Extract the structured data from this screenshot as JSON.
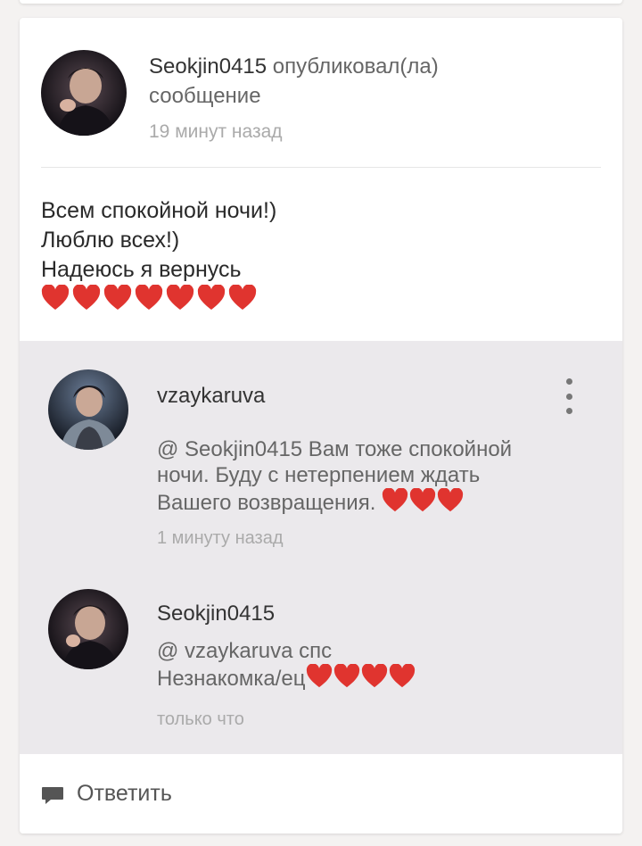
{
  "post": {
    "author": "Seokjin0415",
    "action": "опубликовал(ла)",
    "action_line2": "сообщение",
    "time": "19 минут назад",
    "body": [
      "Всем спокойной ночи!)",
      "Люблю всех!)",
      "Надеюсь я вернусь"
    ],
    "hearts": "❤️❤️❤️❤️❤️❤️❤️"
  },
  "comments": [
    {
      "author": "vzaykaruva",
      "text_line1": "@ Seokjin0415   Вам тоже спокойной",
      "text_line2": "ночи. Буду с нетерпением ждать",
      "text_line3": "Вашего возвращения.",
      "hearts": "❤️❤️❤️",
      "time": "1 минуту назад"
    },
    {
      "author": "Seokjin0415",
      "text_line1": "@ vzaykaruva  спс",
      "text_line2": "Незнакомка/ец",
      "hearts": "❤️❤️❤️❤️",
      "time": "только что"
    }
  ],
  "reply": {
    "label": "Ответить",
    "icon": "comment-icon"
  },
  "colors": {
    "heart": "#e0342f",
    "comments_bg": "#ebe9ec",
    "page_bg": "#f4f2f1"
  }
}
